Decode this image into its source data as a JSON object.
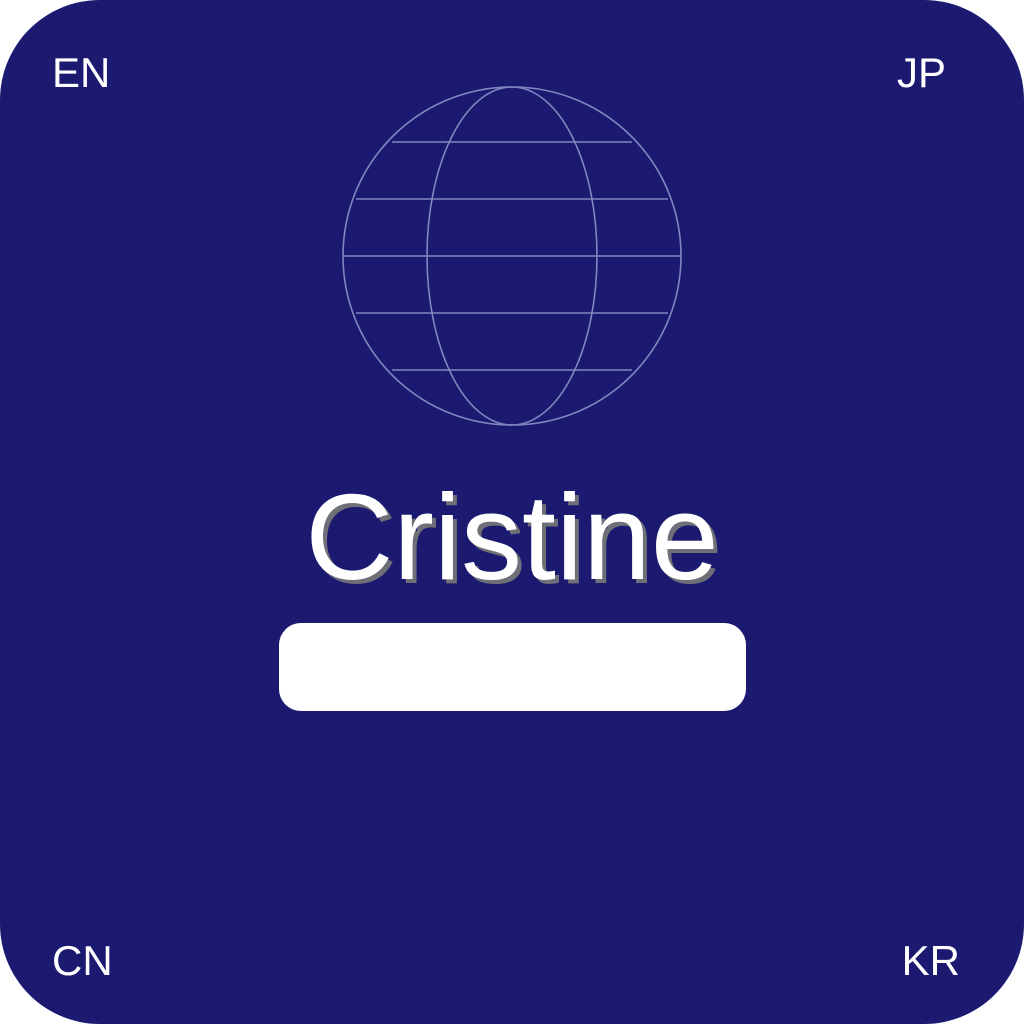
{
  "languages": {
    "top_left": "EN",
    "top_right": "JP",
    "bottom_left": "CN",
    "bottom_right": "KR"
  },
  "name": "Cristine",
  "name_field": {
    "value": ""
  },
  "icons": {
    "globe": "globe-icon"
  },
  "colors": {
    "background": "#1b1a70",
    "globe_stroke": "#7f86c0",
    "text": "#ffffff",
    "text_shadow": "#6f6f78"
  }
}
